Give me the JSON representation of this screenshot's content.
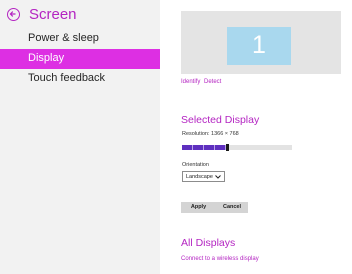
{
  "left_pane": {
    "title": "Screen",
    "nav_items": [
      {
        "label": "Power & sleep"
      },
      {
        "label": "Display"
      },
      {
        "label": "Touch feedback"
      }
    ]
  },
  "display": {
    "monitor_number": "1",
    "identify_label": "Identify",
    "detect_label": "Detect",
    "selected_section_title": "Selected Display",
    "resolution_label": "Resolution: 1366 × 768",
    "resolution_slider_fraction": 0.4,
    "orientation_label": "Orientation",
    "orientation_value": "Landscape",
    "apply_label": "Apply",
    "cancel_label": "Cancel",
    "all_displays_title": "All Displays",
    "wireless_link": "Connect to a wireless display"
  },
  "colors": {
    "accent": "#b425c2",
    "selected_bg": "#dd2fe3",
    "monitor_fill": "#a9d8ee",
    "slider_fill": "#5e2fbf"
  }
}
